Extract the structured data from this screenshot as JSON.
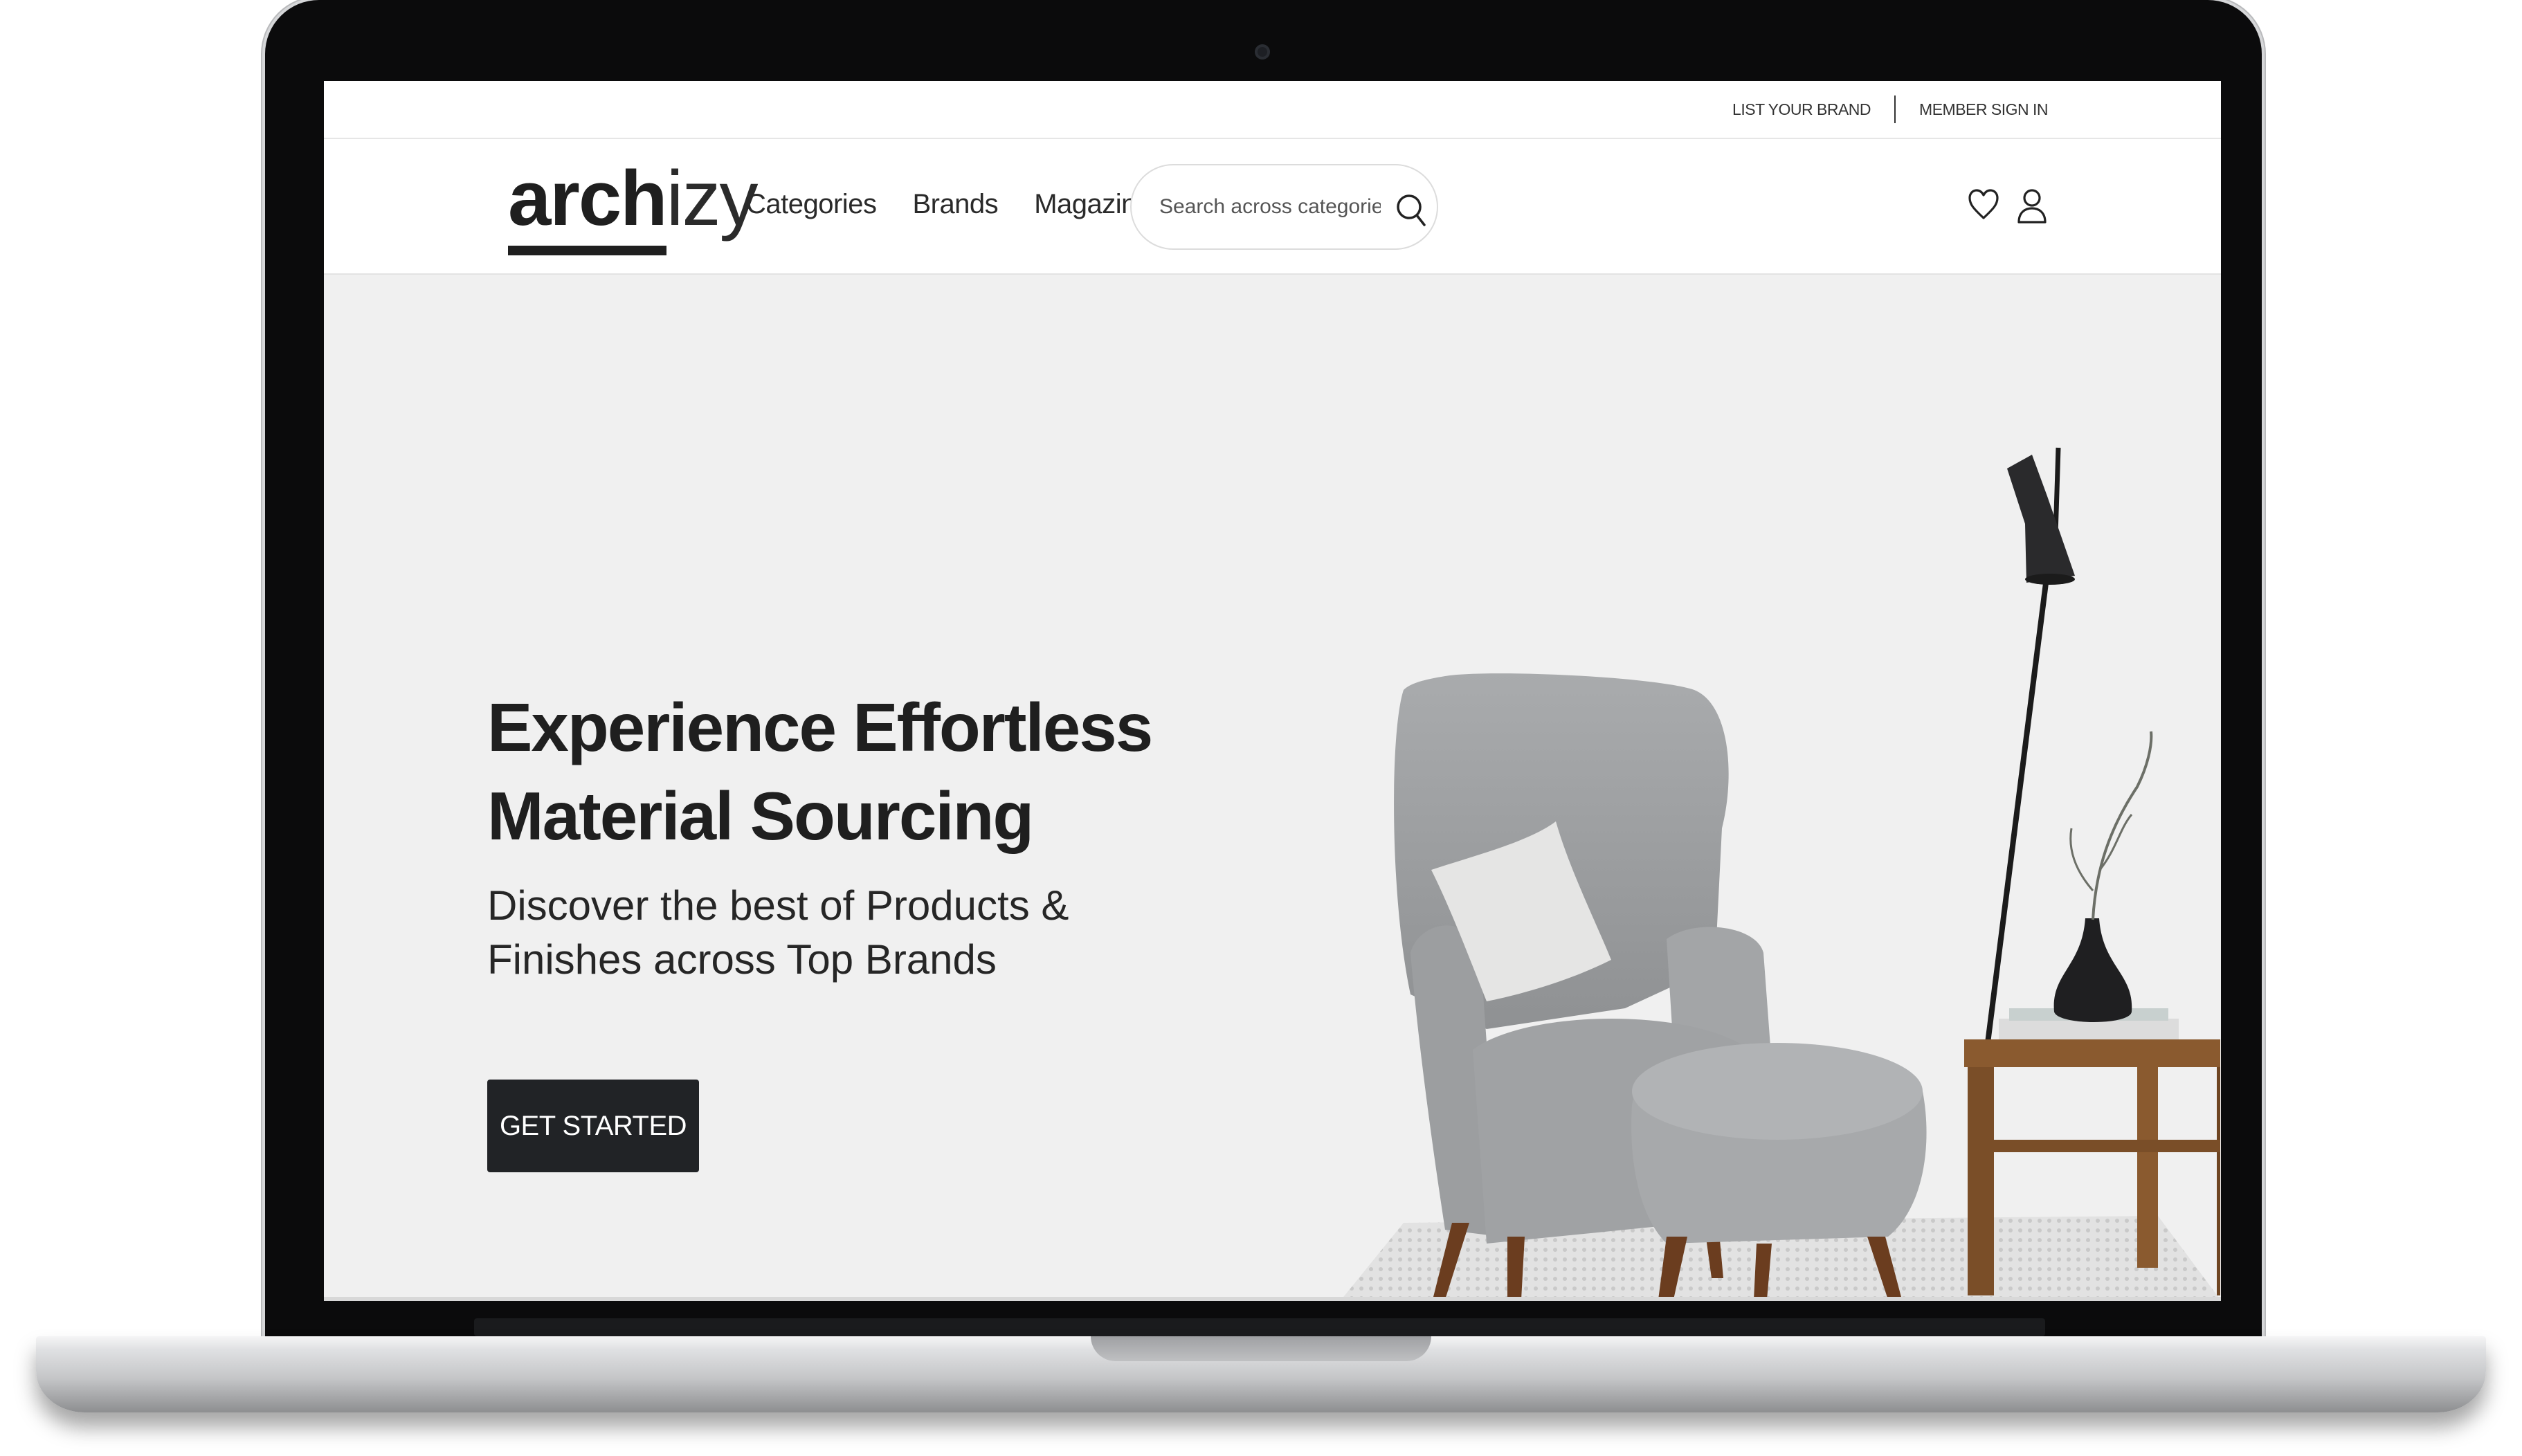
{
  "topbar": {
    "list_brand": "LIST YOUR BRAND",
    "member_sign_in": "MEMBER SIGN IN"
  },
  "header": {
    "logo_bold": "arch",
    "logo_light": "izy",
    "nav": [
      {
        "label": "Categories"
      },
      {
        "label": "Brands"
      },
      {
        "label": "Magazine"
      }
    ],
    "search": {
      "placeholder": "Search across categories, b",
      "icon": "search-icon"
    },
    "icons": [
      "heart-icon",
      "user-icon"
    ]
  },
  "hero": {
    "title_line1": "Experience Effortless",
    "title_line2": "Material Sourcing",
    "subtitle": "Discover the best of Products & Finishes across Top Brands",
    "cta_label": "GET STARTED",
    "image": "armchair-ottoman-lamp-side-table-illustration"
  },
  "colors": {
    "hero_bg": "#f0f0f0",
    "cta_bg": "#212326",
    "text": "#1f1f1f"
  }
}
